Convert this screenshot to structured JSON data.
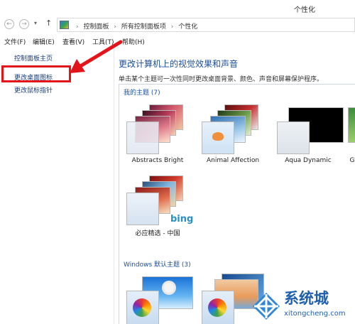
{
  "window": {
    "title": "个性化"
  },
  "address": {
    "crumbs": [
      "控制面板",
      "所有控制面板项",
      "个性化"
    ]
  },
  "menu": {
    "file": "文件(F)",
    "edit": "编辑(E)",
    "view": "查看(V)",
    "tools": "工具(T)",
    "help": "帮助(H)"
  },
  "sidebar": {
    "home": "控制面板主页",
    "desktop_icons": "更改桌面图标",
    "mouse_pointers": "更改鼠标指针"
  },
  "main": {
    "heading": "更改计算机上的视觉效果和声音",
    "subheading": "单击某个主题可一次性同时更改桌面背景、颜色、声音和屏幕保护程序。",
    "my_themes_title": "我的主题 (7)",
    "windows_themes_title": "Windows 默认主题 (3)",
    "themes": [
      {
        "name": "Abstracts Bright"
      },
      {
        "name": "Animal Affection"
      },
      {
        "name": "Aqua Dynamic"
      },
      {
        "name": "G"
      },
      {
        "name": "必应精选 - 中国"
      }
    ],
    "bing_text": "bing"
  },
  "watermark": {
    "brand": "系统城",
    "site": "xitongcheng.com"
  },
  "colors": {
    "highlight": "#e3151b",
    "link": "#1b3c7a",
    "heading": "#1d4f9a"
  }
}
